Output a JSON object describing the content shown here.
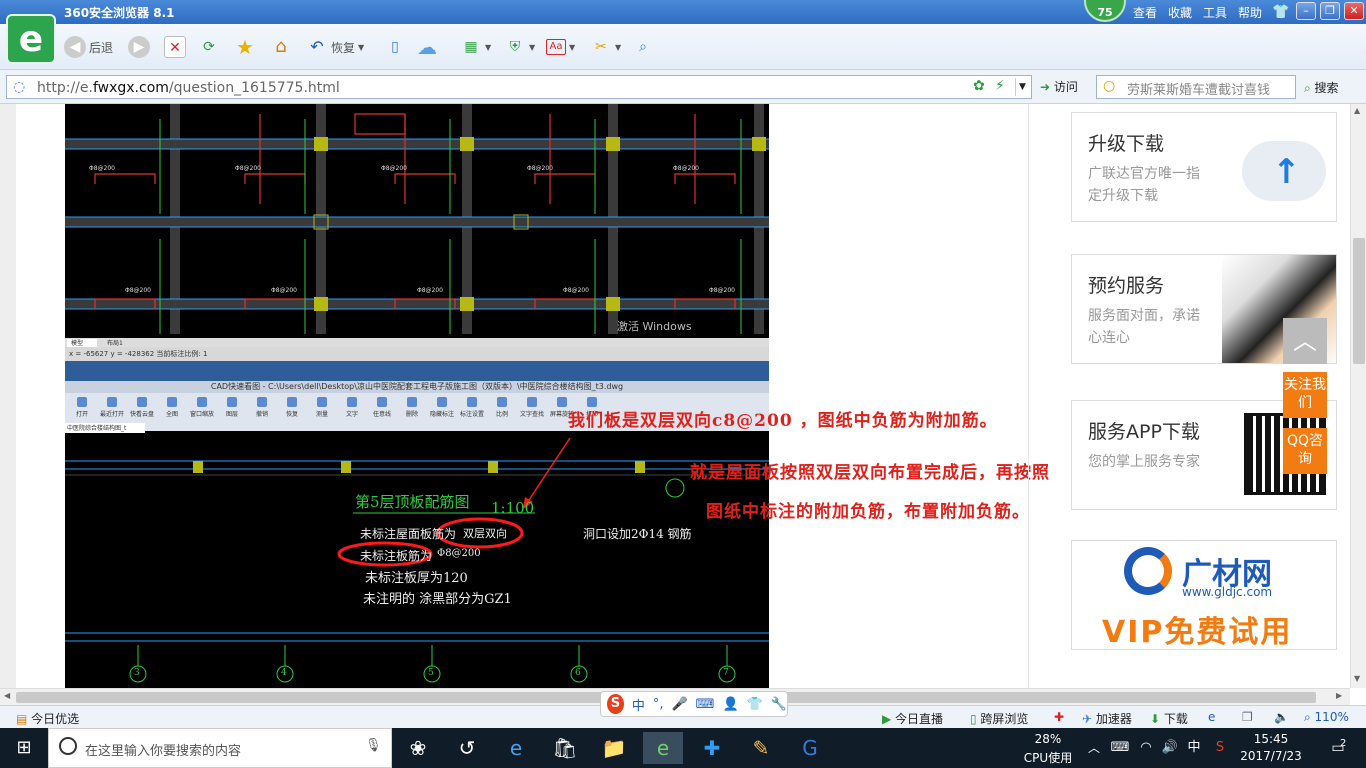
{
  "browser": {
    "title": "360安全浏览器 8.1",
    "badge": "75",
    "menus": [
      "查看",
      "收藏",
      "工具",
      "帮助"
    ],
    "toolbar": {
      "back": "后退",
      "restore": "恢复"
    },
    "url_prefix": "http://e.",
    "url_domain": "fwxgx.com",
    "url_path": "/question_1615775.html",
    "visit": "访问",
    "search_placeholder": "劳斯莱斯婚车遭截讨喜钱",
    "search_btn": "搜索"
  },
  "content": {
    "cad_status": "x = -65627  y = -428362          当前标注比例: 1",
    "watermark": "激活 Windows",
    "cad_title": "CAD快速看图 - C:\\Users\\dell\\Desktop\\凉山中医院配套工程电子版施工图（双版本）\\中医院综合楼结构图_t3.dwg",
    "cad_tools": [
      "打开",
      "最近打开",
      "快看云盘",
      "全图",
      "窗口缩放",
      "图层",
      "撤销",
      "恢复",
      "测量",
      "文字",
      "任意线",
      "删除",
      "隐藏标注",
      "标注设置",
      "比例",
      "文字查找",
      "屏幕旋转",
      "打印"
    ],
    "cad_tab": "中医院综合楼结构图_t",
    "cad_heading": "第5层顶板配筋图",
    "cad_scale": "1:100",
    "cad_line1": "未标注屋面板筋为",
    "cad_line1b": "双层双向",
    "cad_line2": "未标注板筋为",
    "cad_line2b": "Φ8@200",
    "cad_line3": "未标注板厚为120",
    "cad_line4": "未注明的 涂黑部分为GZ1",
    "cad_right": "洞口设加2Φ14 钢筋",
    "note1": "我们板是双层双向c8@200 ，图纸中负筋为附加筋。",
    "note2": "就是屋面板按照双层双向布置完成后，再按照",
    "note3": "图纸中标注的附加负筋，布置附加负筋。",
    "axis_labels": [
      "3",
      "4",
      "5",
      "6",
      "7"
    ]
  },
  "sidebar": {
    "upgrade_title": "升级下载",
    "upgrade_desc": "广联达官方唯一指定升级下载",
    "service_title": "预约服务",
    "service_desc": "服务面对面，承诺心连心",
    "app_title": "服务APP下载",
    "app_desc": "您的掌上服务专家",
    "follow": "关注我们",
    "qq": "QQ咨询",
    "ad_brand": "广材网",
    "ad_url": "www.gldjc.com",
    "ad_vip": "VIP免费试用"
  },
  "statusbar": {
    "today": "今日优选",
    "live": "今日直播",
    "cross": "跨屏浏览",
    "accel": "加速器",
    "download": "下载",
    "zoom": "110%",
    "ime": "中"
  },
  "taskbar": {
    "search": "在这里输入你要搜索的内容",
    "cpu_pct": "28%",
    "cpu_label": "CPU使用",
    "ime": "中",
    "time": "15:45",
    "date": "2017/7/23",
    "notif": "2"
  },
  "colors": {
    "accent": "#2f6cc2",
    "note_red": "#e0201a",
    "orange": "#f27b12",
    "cad_green": "#2ecc40"
  }
}
